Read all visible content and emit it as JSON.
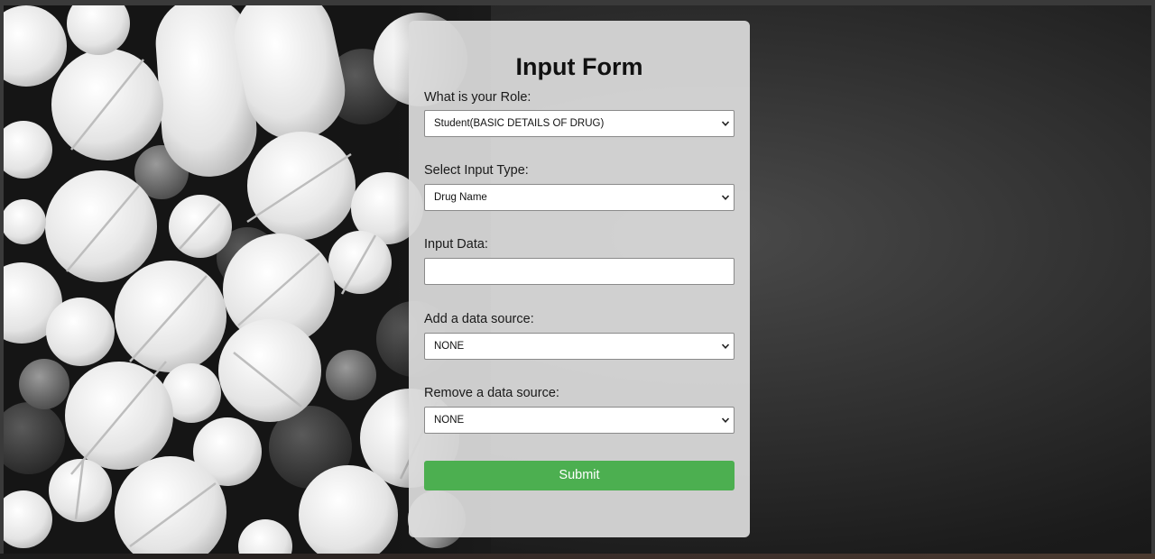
{
  "form": {
    "title": "Input Form",
    "role": {
      "label": "What is your Role:",
      "selected": "Student(BASIC DETAILS OF DRUG)"
    },
    "input_type": {
      "label": "Select Input Type:",
      "selected": "Drug Name"
    },
    "input_data": {
      "label": "Input Data:",
      "value": ""
    },
    "add_source": {
      "label": "Add a data source:",
      "selected": "NONE"
    },
    "remove_source": {
      "label": "Remove a data source:",
      "selected": "NONE"
    },
    "submit_label": "Submit"
  },
  "colors": {
    "submit": "#4caf50",
    "card": "#dcdcdc",
    "background": "#1b1b1b"
  }
}
